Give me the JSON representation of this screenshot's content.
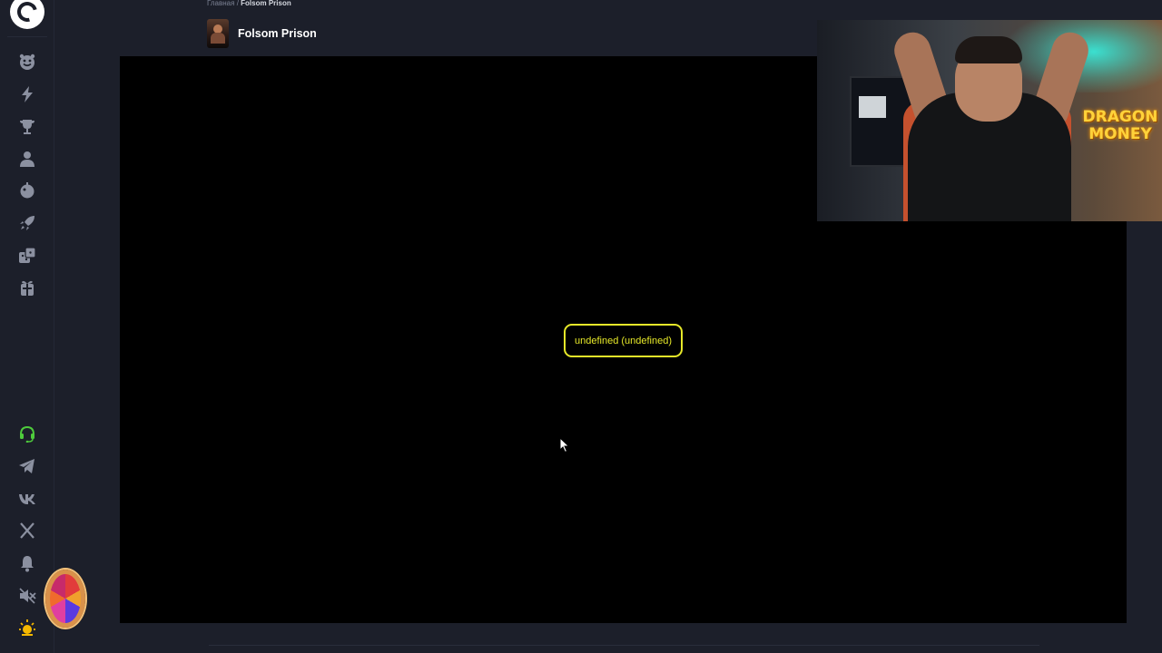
{
  "breadcrumb": {
    "home": "Главная",
    "separator": "/",
    "current": "Folsom Prison"
  },
  "game": {
    "title": "Folsom Prison",
    "error_message": "undefined (undefined)"
  },
  "webcam": {
    "overlay_text_line1": "DRAGON",
    "overlay_text_line2": "MONEY"
  },
  "sidebar": {
    "icons": [
      "smile-icon",
      "lightning-icon",
      "trophy-icon",
      "user-icon",
      "bomb-icon",
      "rocket-icon",
      "dice-icon",
      "gift-icon",
      "support-icon",
      "telegram-icon",
      "vk-icon",
      "x-icon",
      "bell-icon",
      "sound-off-icon",
      "sun-icon"
    ]
  },
  "colors": {
    "background": "#1c1f2a",
    "game_area": "#000000",
    "error_accent": "#e6e829",
    "support_accent": "#4ecb3c",
    "sun_accent": "#f5b800"
  }
}
